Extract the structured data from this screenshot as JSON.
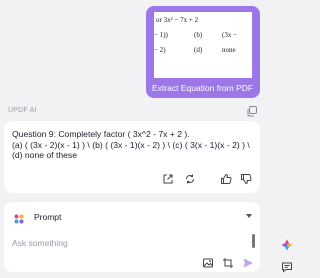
{
  "user_message": {
    "thumbnail_lines": [
      "or 3x² − 7x + 2",
      "− 1))",
      "(b)",
      "(3x −",
      "− 2)",
      "(d)",
      "none"
    ],
    "caption": "Extract Equation from PDF"
  },
  "ai": {
    "label": "UPDF AI",
    "response_lines": [
      "Question 9: Completely factor ( 3x^2 - 7x + 2 ).",
      "(a) ( (3x - 2)(x - 1) ) \\ (b) ( (3x - 1)(x - 2) ) \\ (c) ( 3(x - 1)(x - 2) ) \\",
      "(d) none of these"
    ]
  },
  "prompt": {
    "mode_label": "Prompt",
    "placeholder": "Ask something"
  },
  "icons": {
    "copy": "copy-icon",
    "open_external": "open-external-icon",
    "regenerate": "regenerate-icon",
    "like": "thumbs-up-icon",
    "dislike": "thumbs-down-icon",
    "prompt_mode": "prompt-grid-icon",
    "image": "image-icon",
    "crop": "crop-icon",
    "send": "send-icon",
    "sidebar_app": "updf-ai-icon",
    "sidebar_chat": "chat-icon"
  },
  "colors": {
    "accent": "#9d76e8",
    "background": "#f2f2f5",
    "card": "#ffffff"
  }
}
